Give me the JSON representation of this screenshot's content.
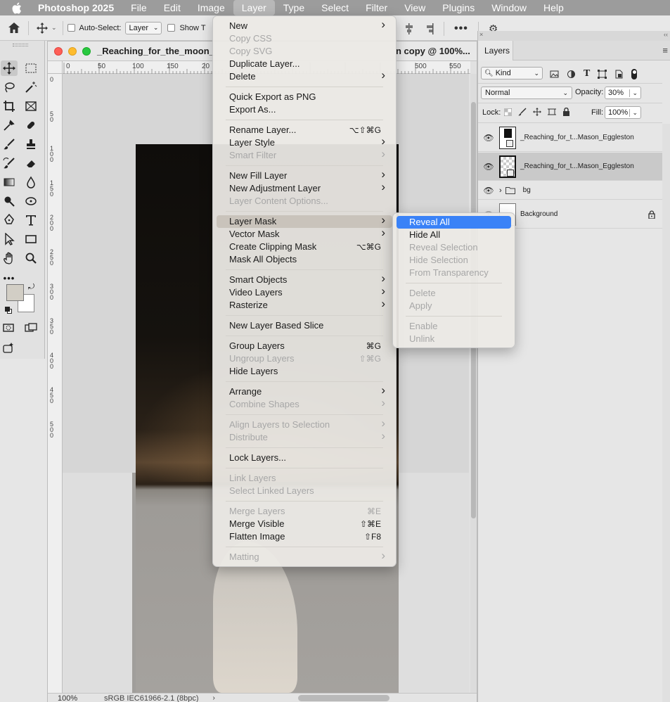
{
  "menubar": {
    "app": "Photoshop 2025",
    "items": [
      "File",
      "Edit",
      "Image",
      "Layer",
      "Type",
      "Select",
      "Filter",
      "View",
      "Plugins",
      "Window",
      "Help"
    ]
  },
  "options": {
    "auto_select_label": "Auto-Select:",
    "auto_select_value": "Layer",
    "show_label": "Show T"
  },
  "document": {
    "title_left": "_Reaching_for_the_moon_",
    "title_right": "n copy @ 100%...",
    "ruler_h": [
      "0",
      "50",
      "100",
      "150",
      "20"
    ],
    "ruler_h_right": [
      "500",
      "550"
    ],
    "ruler_v": [
      "0",
      "5 0",
      "1 0 0",
      "1 5 0",
      "2 0 0",
      "2 5 0",
      "3 0 0",
      "3 5 0",
      "4 0 0",
      "4 5 0",
      "5 0 0"
    ],
    "zoom": "100%",
    "profile": "sRGB IEC61966-2.1 (8bpc)"
  },
  "layers_panel": {
    "tab": "Layers",
    "filter_kind": "Kind",
    "blend_mode": "Normal",
    "opacity_label": "Opacity:",
    "opacity_value": "30%",
    "lock_label": "Lock:",
    "fill_label": "Fill:",
    "fill_value": "100%",
    "layers": [
      {
        "name": "_Reaching_for_t...Mason_Eggleston",
        "selected": false
      },
      {
        "name": "_Reaching_for_t...Mason_Eggleston",
        "selected": true
      },
      {
        "name": "bg",
        "group": true
      },
      {
        "name": "Background",
        "locked": true
      }
    ]
  },
  "layer_menu": {
    "groups": [
      [
        {
          "label": "New",
          "sub": true
        },
        {
          "label": "Copy CSS",
          "dis": true
        },
        {
          "label": "Copy SVG",
          "dis": true
        },
        {
          "label": "Duplicate Layer..."
        },
        {
          "label": "Delete",
          "sub": true
        }
      ],
      [
        {
          "label": "Quick Export as PNG"
        },
        {
          "label": "Export As..."
        }
      ],
      [
        {
          "label": "Rename Layer...",
          "sc": "⌥⇧⌘G"
        },
        {
          "label": "Layer Style",
          "sub": true
        },
        {
          "label": "Smart Filter",
          "sub": true,
          "dis": true
        }
      ],
      [
        {
          "label": "New Fill Layer",
          "sub": true
        },
        {
          "label": "New Adjustment Layer",
          "sub": true
        },
        {
          "label": "Layer Content Options...",
          "dis": true
        }
      ],
      [
        {
          "label": "Layer Mask",
          "sub": true,
          "hl": true
        },
        {
          "label": "Vector Mask",
          "sub": true
        },
        {
          "label": "Create Clipping Mask",
          "sc": "⌥⌘G"
        },
        {
          "label": "Mask All Objects"
        }
      ],
      [
        {
          "label": "Smart Objects",
          "sub": true
        },
        {
          "label": "Video Layers",
          "sub": true
        },
        {
          "label": "Rasterize",
          "sub": true
        }
      ],
      [
        {
          "label": "New Layer Based Slice"
        }
      ],
      [
        {
          "label": "Group Layers",
          "sc": "⌘G"
        },
        {
          "label": "Ungroup Layers",
          "sc": "⇧⌘G",
          "dis": true
        },
        {
          "label": "Hide Layers"
        }
      ],
      [
        {
          "label": "Arrange",
          "sub": true
        },
        {
          "label": "Combine Shapes",
          "sub": true,
          "dis": true
        }
      ],
      [
        {
          "label": "Align Layers to Selection",
          "sub": true,
          "dis": true
        },
        {
          "label": "Distribute",
          "sub": true,
          "dis": true
        }
      ],
      [
        {
          "label": "Lock Layers..."
        }
      ],
      [
        {
          "label": "Link Layers",
          "dis": true
        },
        {
          "label": "Select Linked Layers",
          "dis": true
        }
      ],
      [
        {
          "label": "Merge Layers",
          "sc": "⌘E",
          "dis": true
        },
        {
          "label": "Merge Visible",
          "sc": "⇧⌘E"
        },
        {
          "label": "Flatten Image",
          "sc": "⇧F8"
        }
      ],
      [
        {
          "label": "Matting",
          "sub": true,
          "dis": true
        }
      ]
    ]
  },
  "mask_submenu": {
    "groups": [
      [
        {
          "label": "Reveal All",
          "blue": true
        },
        {
          "label": "Hide All"
        },
        {
          "label": "Reveal Selection",
          "dis": true
        },
        {
          "label": "Hide Selection",
          "dis": true
        },
        {
          "label": "From Transparency",
          "dis": true
        }
      ],
      [
        {
          "label": "Delete",
          "dis": true
        },
        {
          "label": "Apply",
          "dis": true
        }
      ],
      [
        {
          "label": "Enable",
          "dis": true
        },
        {
          "label": "Unlink",
          "dis": true
        }
      ]
    ]
  }
}
